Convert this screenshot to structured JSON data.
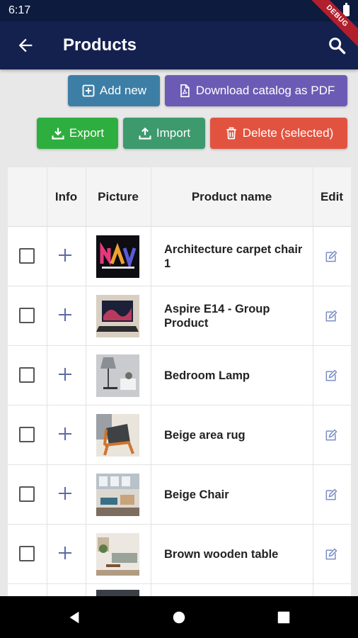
{
  "status": {
    "time": "6:17"
  },
  "debug_banner": "DEBUG",
  "appbar": {
    "title": "Products",
    "back_icon": "arrow-left-icon",
    "search_icon": "search-icon"
  },
  "actions": {
    "add_new": "Add new",
    "download_catalog": "Download catalog as PDF",
    "export": "Export",
    "import": "Import",
    "delete_selected": "Delete (selected)"
  },
  "colors": {
    "appbar": "#14214f",
    "add_new": "#3d7ea6",
    "download": "#6c5bb4",
    "export": "#2eae3f",
    "import": "#3c9a6d",
    "delete": "#e2533f"
  },
  "table": {
    "headers": {
      "info": "Info",
      "picture": "Picture",
      "product_name": "Product name",
      "edit": "Edit"
    },
    "rows": [
      {
        "name": "Architecture carpet chair 1",
        "picture": "nav-logo-image"
      },
      {
        "name": "Aspire E14 - Group Product",
        "picture": "laptop-image"
      },
      {
        "name": "Bedroom Lamp",
        "picture": "lamp-image"
      },
      {
        "name": "Beige area rug",
        "picture": "chair-image"
      },
      {
        "name": "Beige Chair",
        "picture": "interior-image"
      },
      {
        "name": "Brown wooden table",
        "picture": "living-room-image"
      }
    ]
  }
}
